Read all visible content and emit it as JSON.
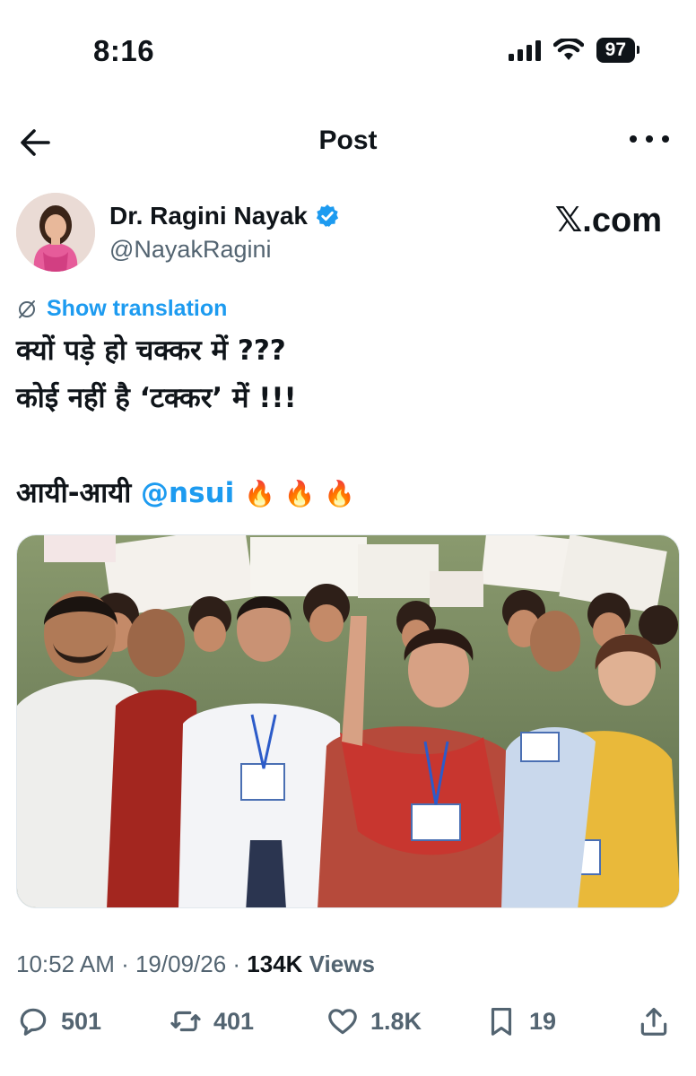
{
  "status_bar": {
    "time": "8:16",
    "battery": "97"
  },
  "header": {
    "title": "Post"
  },
  "author": {
    "name": "Dr. Ragini Nayak",
    "handle": "@NayakRagini",
    "verified": true
  },
  "watermark": "𝕏.com",
  "translation": {
    "label": "Show translation"
  },
  "tweet": {
    "line1": "क्यों पड़े हो चक्कर में ???",
    "line2": "कोई नहीं है ‘टक्कर’ में !!!",
    "line3_prefix": "आयी-आयी ",
    "mention": "@nsui",
    "emoji": "🔥 🔥 🔥"
  },
  "meta": {
    "time": "10:52 AM",
    "separator1": " · ",
    "date": "19/09/26",
    "separator2": " · ",
    "views_count": "134K",
    "views_label": " Views"
  },
  "actions": {
    "replies": "501",
    "reposts": "401",
    "likes": "1.8K",
    "bookmarks": "19"
  },
  "colors": {
    "accent": "#1d9bf0",
    "text_primary": "#0f1419",
    "text_secondary": "#536471"
  }
}
